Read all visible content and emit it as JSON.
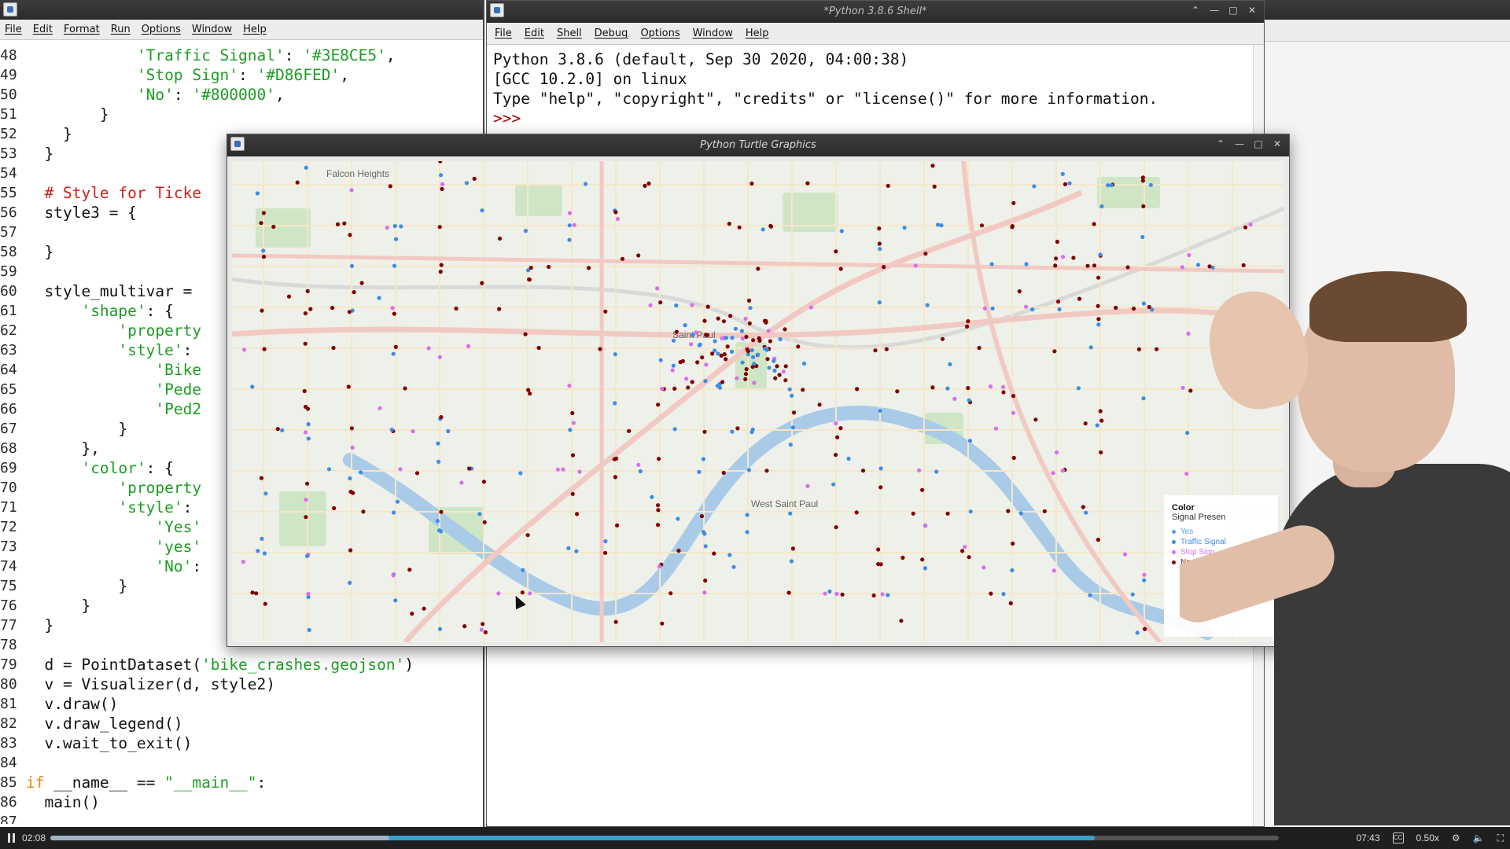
{
  "editor": {
    "menu": [
      "File",
      "Edit",
      "Format",
      "Run",
      "Options",
      "Window",
      "Help"
    ],
    "lines": [
      {
        "n": "48",
        "tokens": [
          [
            "",
            "            "
          ],
          [
            "str",
            "'Traffic Signal'"
          ],
          [
            "",
            ": "
          ],
          [
            "str",
            "'#3E8CE5'"
          ],
          [
            "",
            ","
          ]
        ]
      },
      {
        "n": "49",
        "tokens": [
          [
            "",
            "            "
          ],
          [
            "str",
            "'Stop Sign'"
          ],
          [
            "",
            ": "
          ],
          [
            "str",
            "'#D86FED'"
          ],
          [
            "",
            ","
          ]
        ]
      },
      {
        "n": "50",
        "tokens": [
          [
            "",
            "            "
          ],
          [
            "str",
            "'No'"
          ],
          [
            "",
            ": "
          ],
          [
            "str",
            "'#800000'"
          ],
          [
            "",
            ","
          ]
        ]
      },
      {
        "n": "51",
        "tokens": [
          [
            "",
            "        }"
          ]
        ]
      },
      {
        "n": "52",
        "tokens": [
          [
            "",
            "    }"
          ]
        ]
      },
      {
        "n": "53",
        "tokens": [
          [
            "",
            "  }"
          ]
        ]
      },
      {
        "n": "54",
        "tokens": [
          [
            "",
            ""
          ]
        ]
      },
      {
        "n": "55",
        "tokens": [
          [
            "",
            "  "
          ],
          [
            "cmt",
            "# Style for Ticke"
          ]
        ]
      },
      {
        "n": "56",
        "tokens": [
          [
            "",
            "  style3 = {"
          ]
        ]
      },
      {
        "n": "57",
        "tokens": [
          [
            "",
            ""
          ]
        ]
      },
      {
        "n": "58",
        "tokens": [
          [
            "",
            "  }"
          ]
        ]
      },
      {
        "n": "59",
        "tokens": [
          [
            "",
            ""
          ]
        ]
      },
      {
        "n": "60",
        "tokens": [
          [
            "",
            "  style_multivar ="
          ]
        ]
      },
      {
        "n": "61",
        "tokens": [
          [
            "",
            "      "
          ],
          [
            "str",
            "'shape'"
          ],
          [
            "",
            ": {"
          ]
        ]
      },
      {
        "n": "62",
        "tokens": [
          [
            "",
            "          "
          ],
          [
            "str",
            "'property"
          ]
        ]
      },
      {
        "n": "63",
        "tokens": [
          [
            "",
            "          "
          ],
          [
            "str",
            "'style'"
          ],
          [
            "",
            ":"
          ]
        ]
      },
      {
        "n": "64",
        "tokens": [
          [
            "",
            "              "
          ],
          [
            "str",
            "'Bike"
          ]
        ]
      },
      {
        "n": "65",
        "tokens": [
          [
            "",
            "              "
          ],
          [
            "str",
            "'Pede"
          ]
        ]
      },
      {
        "n": "66",
        "tokens": [
          [
            "",
            "              "
          ],
          [
            "str",
            "'Ped2"
          ]
        ]
      },
      {
        "n": "67",
        "tokens": [
          [
            "",
            "          }"
          ]
        ]
      },
      {
        "n": "68",
        "tokens": [
          [
            "",
            "      },"
          ]
        ]
      },
      {
        "n": "69",
        "tokens": [
          [
            "",
            "      "
          ],
          [
            "str",
            "'color'"
          ],
          [
            "",
            ": {"
          ]
        ]
      },
      {
        "n": "70",
        "tokens": [
          [
            "",
            "          "
          ],
          [
            "str",
            "'property"
          ]
        ]
      },
      {
        "n": "71",
        "tokens": [
          [
            "",
            "          "
          ],
          [
            "str",
            "'style'"
          ],
          [
            "",
            ":"
          ]
        ]
      },
      {
        "n": "72",
        "tokens": [
          [
            "",
            "              "
          ],
          [
            "str",
            "'Yes'"
          ]
        ]
      },
      {
        "n": "73",
        "tokens": [
          [
            "",
            "              "
          ],
          [
            "str",
            "'yes'"
          ]
        ]
      },
      {
        "n": "74",
        "tokens": [
          [
            "",
            "              "
          ],
          [
            "str",
            "'No'"
          ],
          [
            "",
            ":"
          ]
        ]
      },
      {
        "n": "75",
        "tokens": [
          [
            "",
            "          }"
          ]
        ]
      },
      {
        "n": "76",
        "tokens": [
          [
            "",
            "      }"
          ]
        ]
      },
      {
        "n": "77",
        "tokens": [
          [
            "",
            "  }"
          ]
        ]
      },
      {
        "n": "78",
        "tokens": [
          [
            "",
            ""
          ]
        ]
      },
      {
        "n": "79",
        "tokens": [
          [
            "",
            "  d = PointDataset("
          ],
          [
            "str",
            "'bike_crashes.geojson'"
          ],
          [
            "",
            ")"
          ]
        ]
      },
      {
        "n": "80",
        "tokens": [
          [
            "",
            "  v = Visualizer(d, style2)"
          ]
        ]
      },
      {
        "n": "81",
        "tokens": [
          [
            "",
            "  v.draw()"
          ]
        ]
      },
      {
        "n": "82",
        "tokens": [
          [
            "",
            "  v.draw_legend()"
          ]
        ]
      },
      {
        "n": "83",
        "tokens": [
          [
            "",
            "  v.wait_to_exit()"
          ]
        ]
      },
      {
        "n": "84",
        "tokens": [
          [
            "",
            ""
          ]
        ]
      },
      {
        "n": "85",
        "tokens": [
          [
            "kw",
            "if"
          ],
          [
            "",
            " __name__ == "
          ],
          [
            "str",
            "\"__main__\""
          ],
          [
            "",
            ":"
          ]
        ]
      },
      {
        "n": "86",
        "tokens": [
          [
            "",
            "  main()"
          ]
        ]
      },
      {
        "n": "87",
        "tokens": [
          [
            "",
            ""
          ]
        ]
      }
    ]
  },
  "shell": {
    "title": "*Python 3.8.6 Shell*",
    "menu": [
      "File",
      "Edit",
      "Shell",
      "Debug",
      "Options",
      "Window",
      "Help"
    ],
    "output": [
      "Python 3.8.6 (default, Sep 30 2020, 04:00:38)",
      "[GCC 10.2.0] on linux",
      "Type \"help\", \"copyright\", \"credits\" or \"license()\" for more information."
    ],
    "prompt": ">>>"
  },
  "turtle": {
    "title": "Python Turtle Graphics",
    "legend": {
      "title": "Color",
      "subtitle": "Signal Presen",
      "items": [
        {
          "label": "Yes",
          "color": "#5aa0e8"
        },
        {
          "label": "Traffic Signal",
          "color": "#3E8CE5"
        },
        {
          "label": "Stop Sign",
          "color": "#D86FED"
        },
        {
          "label": "No",
          "color": "#800000"
        }
      ]
    },
    "map_labels": [
      "Falcon Heights",
      "Saint Paul",
      "West Saint Paul"
    ],
    "colors": {
      "blue": "#3E8CE5",
      "pink": "#D86FED",
      "red": "#800000",
      "road": "#f2c9c2",
      "park": "#cfe6c6",
      "water": "#a9cbe8"
    }
  },
  "player": {
    "elapsed": "02:08",
    "total": "07:43",
    "speed": "0.50x",
    "progress_fraction": 0.276,
    "buffer_fraction": 0.85
  }
}
